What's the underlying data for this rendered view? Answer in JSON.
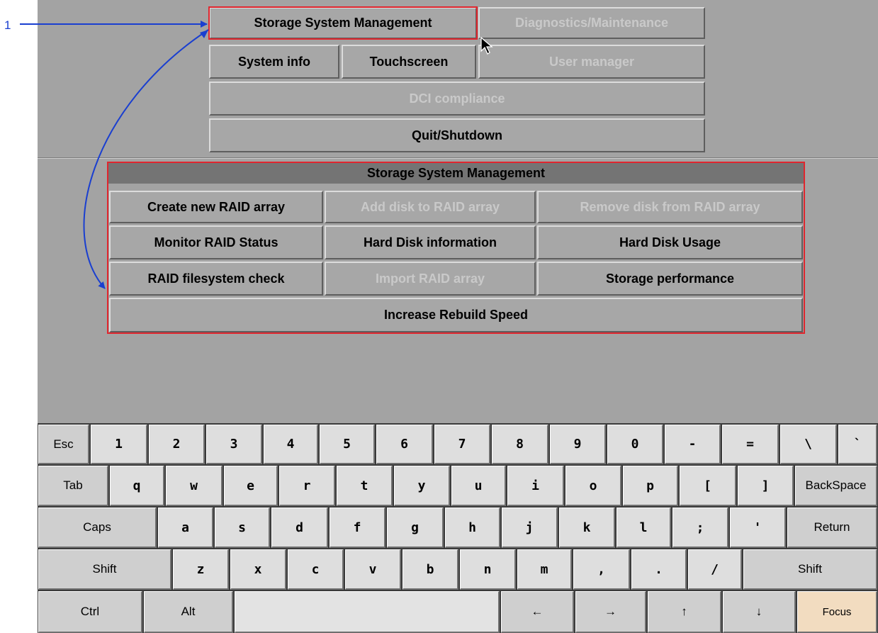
{
  "annotation": {
    "label": "1"
  },
  "top_menu": {
    "storage_system_management": "Storage System Management",
    "diagnostics_maintenance": "Diagnostics/Maintenance",
    "system_info": "System info",
    "touchscreen": "Touchscreen",
    "user_manager": "User manager",
    "dci_compliance": "DCI compliance",
    "quit_shutdown": "Quit/Shutdown"
  },
  "storage_panel": {
    "title": "Storage System Management",
    "create_new_raid_array": "Create new RAID array",
    "add_disk_to_raid_array": "Add disk to RAID array",
    "remove_disk_from_raid_array": "Remove disk from RAID array",
    "monitor_raid_status": "Monitor RAID Status",
    "hard_disk_information": "Hard Disk information",
    "hard_disk_usage": "Hard Disk Usage",
    "raid_filesystem_check": "RAID filesystem check",
    "import_raid_array": "Import RAID array",
    "storage_performance": "Storage performance",
    "increase_rebuild_speed": "Increase Rebuild Speed"
  },
  "keyboard": {
    "row1": [
      "Esc",
      "1",
      "2",
      "3",
      "4",
      "5",
      "6",
      "7",
      "8",
      "9",
      "0",
      "-",
      "=",
      "\\",
      "`"
    ],
    "row2": [
      "Tab",
      "q",
      "w",
      "e",
      "r",
      "t",
      "y",
      "u",
      "i",
      "o",
      "p",
      "[",
      "]",
      "BackSpace"
    ],
    "row3": [
      "Caps",
      "a",
      "s",
      "d",
      "f",
      "g",
      "h",
      "j",
      "k",
      "l",
      ";",
      "'",
      "Return"
    ],
    "row4": [
      "Shift",
      "z",
      "x",
      "c",
      "v",
      "b",
      "n",
      "m",
      ",",
      ".",
      "/",
      "Shift"
    ],
    "row5": [
      "Ctrl",
      "Alt",
      "",
      "←",
      "→",
      "↑",
      "↓",
      "Focus"
    ]
  },
  "colors": {
    "highlight": "#e0262e",
    "annotation": "#1a3fd0",
    "focus_key": "#f2dcc0"
  }
}
